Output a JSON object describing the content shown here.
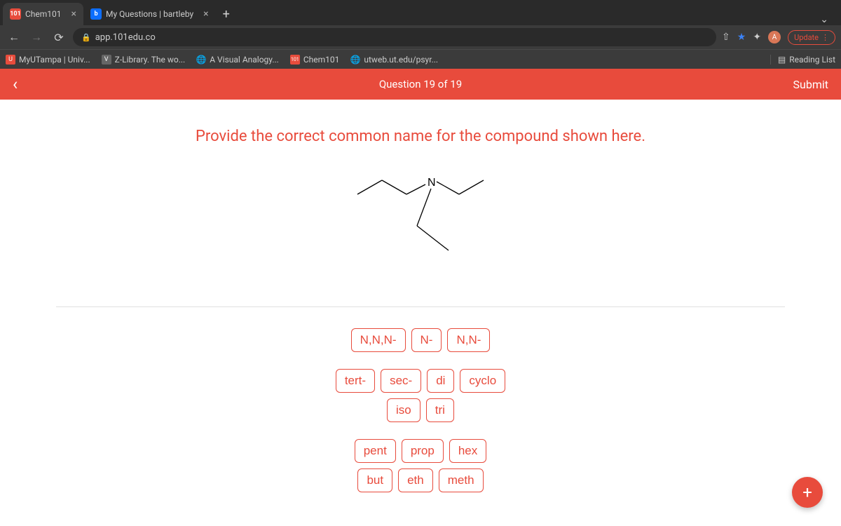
{
  "tabs": [
    {
      "title": "Chem101",
      "favicon_label": "101"
    },
    {
      "title": "My Questions | bartleby",
      "favicon_label": "b"
    }
  ],
  "url_bar": {
    "text": "app.101edu.co"
  },
  "toolbar": {
    "avatar_letter": "A",
    "update_label": "Update"
  },
  "bookmarks": [
    {
      "label": "MyUTampa | Univ..."
    },
    {
      "label": "Z-Library. The wo..."
    },
    {
      "label": "A Visual Analogy..."
    },
    {
      "label": "Chem101"
    },
    {
      "label": "utweb.ut.edu/psyr..."
    }
  ],
  "reading_list_label": "Reading List",
  "app_header": {
    "counter": "Question 19 of 19",
    "submit": "Submit"
  },
  "prompt": "Provide the correct common name for the compound shown here.",
  "nitrogen_label": "N",
  "choices": {
    "group1_row1": [
      "N,N,N-",
      "N-",
      "N,N-"
    ],
    "group2_row1": [
      "tert-",
      "sec-",
      "di",
      "cyclo"
    ],
    "group2_row2": [
      "iso",
      "tri"
    ],
    "group3_row1": [
      "pent",
      "prop",
      "hex"
    ],
    "group3_row2": [
      "but",
      "eth",
      "meth"
    ]
  }
}
